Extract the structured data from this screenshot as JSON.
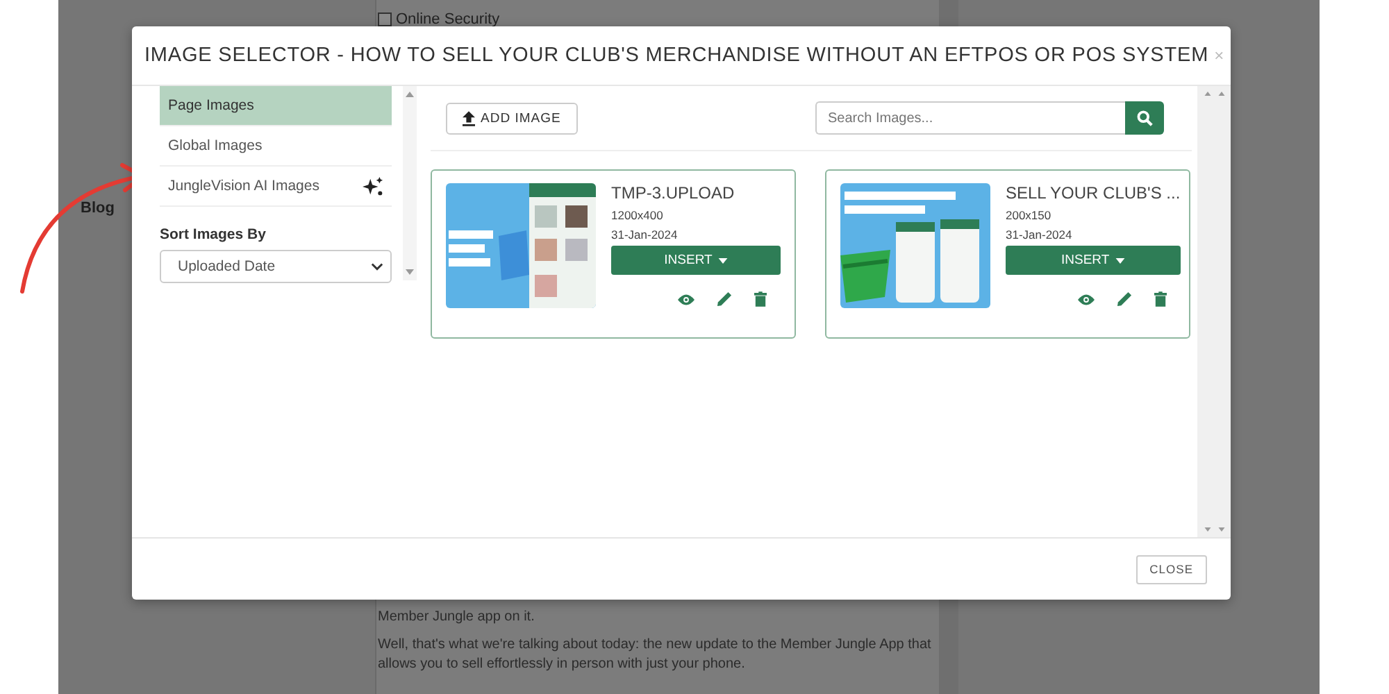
{
  "background_page": {
    "checkbox": {
      "label": "Online Security",
      "checked": false
    },
    "sidebar_label": "Blog",
    "paragraphs": [
      "Member Jungle app on it.",
      "Well, that's what we're talking about today: the new update to the Member Jungle App that allows you to sell effortlessly in person with just your phone."
    ]
  },
  "modal": {
    "title": "IMAGE SELECTOR - HOW TO SELL YOUR CLUB'S MERCHANDISE WITHOUT AN EFTPOS OR POS SYSTEM",
    "close_icon": "×",
    "sidebar": {
      "items": [
        {
          "label": "Page Images",
          "selected": true,
          "kind": "plain"
        },
        {
          "label": "Global Images",
          "selected": false,
          "kind": "plain"
        },
        {
          "label": "JungleVision AI Images",
          "selected": false,
          "kind": "ai"
        }
      ],
      "sort_label": "Sort Images By",
      "sort_value": "Uploaded Date"
    },
    "add_button": "ADD IMAGE",
    "search": {
      "placeholder": "Search Images..."
    },
    "images": [
      {
        "name": "TMP-3.UPLOAD",
        "size": "1200x400",
        "date": "31-Jan-2024",
        "insert_label": "INSERT"
      },
      {
        "name": "SELL YOUR CLUB'S ...",
        "size": "200x150",
        "date": "31-Jan-2024",
        "insert_label": "INSERT"
      }
    ],
    "footer_button": "CLOSE"
  }
}
